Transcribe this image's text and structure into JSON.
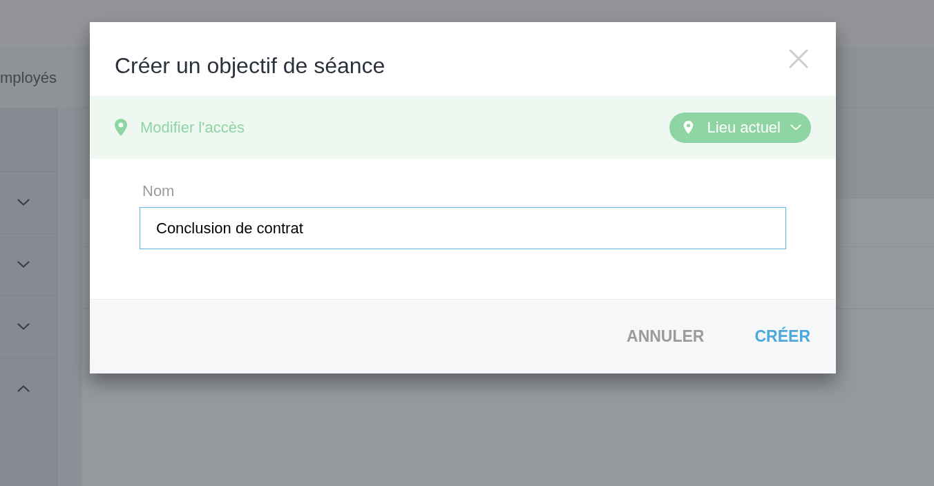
{
  "background": {
    "nav_tab": "mployés",
    "sidebar_rows": [
      {
        "expanded": false
      },
      {
        "expanded": false
      },
      {
        "expanded": false
      },
      {
        "expanded": true
      }
    ]
  },
  "dialog": {
    "title": "Créer un objectif de séance",
    "access_bar": {
      "label": "Modifier l'accès",
      "location_button": "Lieu actuel"
    },
    "name_field": {
      "label": "Nom",
      "value": "Conclusion de contrat",
      "focused": true
    },
    "buttons": [
      {
        "label": "ANNULER",
        "kind": "secondary"
      },
      {
        "label": "CRÉER",
        "kind": "primary"
      }
    ]
  }
}
